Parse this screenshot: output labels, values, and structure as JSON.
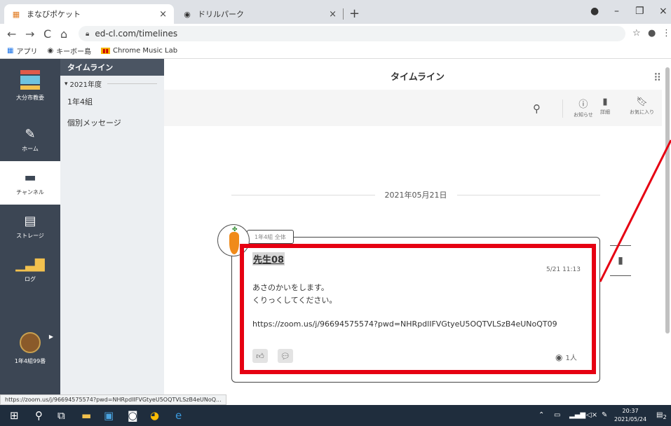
{
  "browser": {
    "tabs": [
      {
        "title": "まなびポケット",
        "close": "×"
      },
      {
        "title": "ドリルパーク",
        "close": "×"
      }
    ],
    "new_tab": "+",
    "window_controls": {
      "minimize": "–",
      "maximize": "❐",
      "close": "×"
    },
    "nav": {
      "back": "←",
      "forward": "→",
      "reload": "C",
      "home": "⌂"
    },
    "url": "ed-cl.com/timelines",
    "bookmarks": [
      {
        "label": "アプリ",
        "icon": "apps-grid-icon"
      },
      {
        "label": "キーボー島",
        "icon": "globe-icon"
      },
      {
        "label": "Chrome Music Lab",
        "icon": "music-lab-icon"
      }
    ]
  },
  "app": {
    "logo_label": "大分市教委",
    "nav_items": [
      {
        "label": "ホーム",
        "icon": "pencil-icon"
      },
      {
        "label": "チャンネル",
        "icon": "chat-icon"
      },
      {
        "label": "ストレージ",
        "icon": "document-icon"
      },
      {
        "label": "ログ",
        "icon": "bar-chart-icon"
      }
    ],
    "account_label": "1年4組99番",
    "subnav": {
      "header": "タイムライン",
      "year": "2021年度",
      "year_caret": "▾",
      "items": [
        "1年4組",
        "個別メッセージ"
      ]
    },
    "main": {
      "title": "タイムライン",
      "toolbar": [
        {
          "label": "お知らせ",
          "icon": "info-icon"
        },
        {
          "label": "詳細",
          "icon": "detail-icon"
        },
        {
          "label": "お気に入り",
          "icon": "bookmark-icon"
        }
      ],
      "date": "2021年05月21日",
      "post": {
        "tag": "1年4組 全体",
        "author": "先生08",
        "time": "5/21 11:13",
        "body_line1": "あさのかいをします。",
        "body_line2": "くりっくしてください。",
        "link": "https://zoom.us/j/96694575574?pwd=NHRpdlIFVGtyeU5OQTVLSzB4eUNoQT09",
        "views": "1人"
      }
    }
  },
  "status_url": "https://zoom.us/j/96694575574?pwd=NHRpdlIFVGtyeU5OQTVLSzB4eUNoQ...",
  "taskbar": {
    "time": "20:37",
    "date": "2021/05/24",
    "notification_count": "2"
  },
  "colors": {
    "highlight": "#e60012",
    "nav_bg": "#3c4654"
  }
}
